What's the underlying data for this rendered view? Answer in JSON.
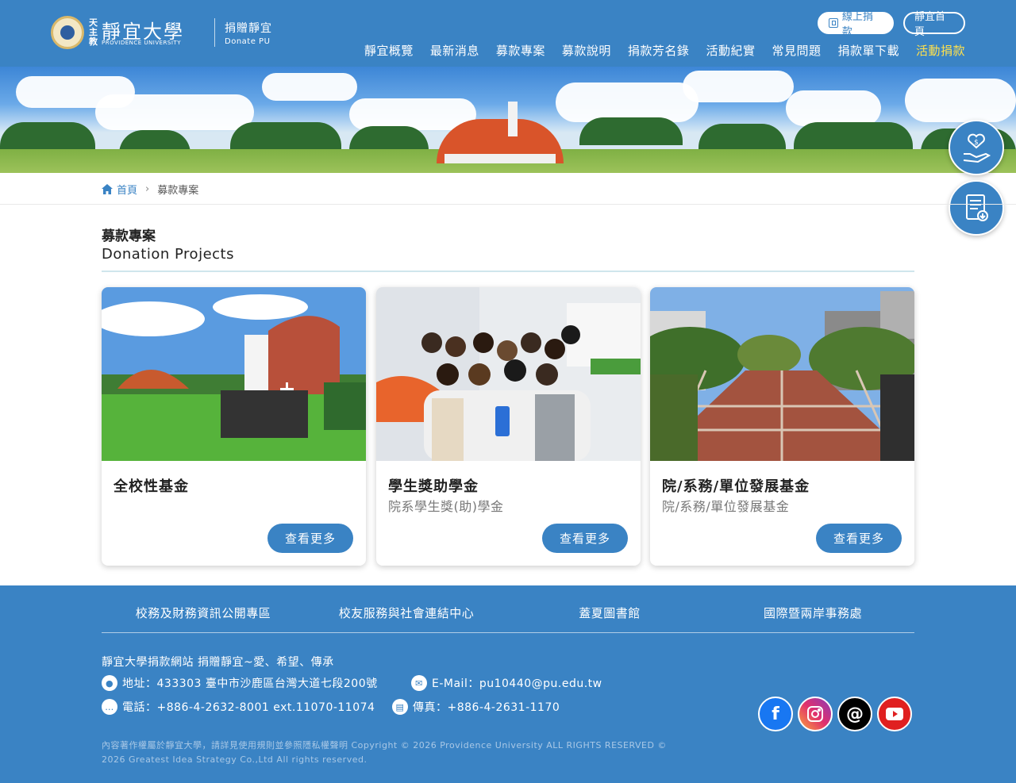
{
  "header": {
    "logo_side": "天主教",
    "logo_cn": "靜宜大學",
    "logo_en": "PROVIDENCE UNIVERSITY",
    "logo_sub_cn": "捐贈靜宜",
    "logo_sub_en": "Donate PU",
    "online_donate": "線上捐款",
    "home_link": "靜宜首頁",
    "nav": [
      "靜宜概覽",
      "最新消息",
      "募款專案",
      "募款說明",
      "捐款芳名錄",
      "活動紀實",
      "常見問題",
      "捐款單下載",
      "活動捐款"
    ]
  },
  "breadcrumb": {
    "home": "首頁",
    "current": "募款專案"
  },
  "section": {
    "title_cn": "募款專案",
    "title_en": "Donation Projects"
  },
  "cards": [
    {
      "title": "全校性基金",
      "subtitle": "",
      "button": "查看更多"
    },
    {
      "title": "學生獎助學金",
      "subtitle": "院系學生獎(助)學金",
      "button": "查看更多"
    },
    {
      "title": "院/系務/單位發展基金",
      "subtitle": "院/系務/單位發展基金",
      "button": "查看更多"
    }
  ],
  "footer": {
    "links": [
      "校務及財務資訊公開專區",
      "校友服務與社會連結中心",
      "蓋夏圖書館",
      "國際暨兩岸事務處"
    ],
    "slogan": "靜宜大學捐款網站 捐贈靜宜~愛、希望、傳承",
    "address": "地址：433303 臺中市沙鹿區台灣大道七段200號",
    "email": "E-Mail：pu10440@pu.edu.tw",
    "phone": "電話：+886-4-2632-8001 ext.11070-11074",
    "fax": "傳真：+886-4-2631-1170",
    "copyright": "內容著作權屬於靜宜大學，請詳見使用規則並參照隱私權聲明 Copyright © 2026 Providence University ALL RIGHTS RESERVED © 2026 Greatest Idea Strategy Co.,Ltd All rights reserved."
  },
  "colors": {
    "primary": "#3a83c4",
    "active_nav": "#ffe14d",
    "footer": "#3a83c4"
  }
}
